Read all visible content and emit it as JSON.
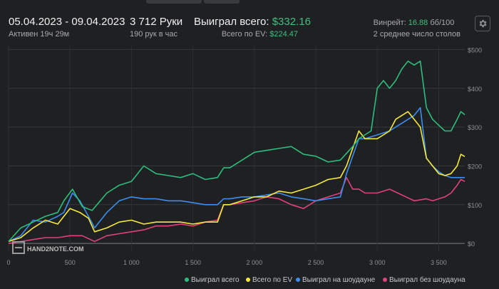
{
  "header": {
    "date_range": "05.04.2023 - 09.04.2023",
    "active_time": "Активен 19ч 29м",
    "hands": "3 712 Руки",
    "hands_per_hour": "190 рук в час",
    "won_total_label": "Выиграл всего:",
    "won_total_value": "$332.16",
    "ev_total_label": "Всего по EV:",
    "ev_total_value": "$224.47",
    "winrate_label": "Винрейт:",
    "winrate_value": "16.88",
    "winrate_unit": "бб/100",
    "avg_tables": "2 среднее число столов"
  },
  "watermark": "HAND2NOTE.COM",
  "colors": {
    "green": "#2dbd7e",
    "yellow": "#f5e93c",
    "blue": "#3b8df0",
    "pink": "#e0417a",
    "accent": "#3fbf7f"
  },
  "icons": {
    "settings": "gear-icon"
  },
  "chart_data": {
    "type": "line",
    "x_ticks": [
      "0",
      "500",
      "1 000",
      "1 500",
      "2 000",
      "2 500",
      "3 000",
      "3 500"
    ],
    "y_ticks": [
      "$0",
      "$100",
      "$200",
      "$300",
      "$400",
      "$500"
    ],
    "xlim": [
      0,
      3712
    ],
    "ylim": [
      -20,
      510
    ],
    "grid": true,
    "legend_position": "bottom",
    "series": [
      {
        "name": "Выиграл всего",
        "color": "#2dbd7e",
        "points": [
          [
            0,
            5
          ],
          [
            100,
            40
          ],
          [
            200,
            55
          ],
          [
            300,
            70
          ],
          [
            400,
            80
          ],
          [
            450,
            110
          ],
          [
            520,
            140
          ],
          [
            600,
            95
          ],
          [
            680,
            85
          ],
          [
            720,
            100
          ],
          [
            800,
            130
          ],
          [
            900,
            150
          ],
          [
            1000,
            160
          ],
          [
            1100,
            200
          ],
          [
            1200,
            180
          ],
          [
            1300,
            175
          ],
          [
            1400,
            170
          ],
          [
            1500,
            180
          ],
          [
            1600,
            165
          ],
          [
            1700,
            170
          ],
          [
            1750,
            195
          ],
          [
            1800,
            195
          ],
          [
            1900,
            215
          ],
          [
            2000,
            235
          ],
          [
            2100,
            240
          ],
          [
            2200,
            245
          ],
          [
            2300,
            250
          ],
          [
            2400,
            230
          ],
          [
            2500,
            225
          ],
          [
            2600,
            210
          ],
          [
            2700,
            215
          ],
          [
            2800,
            250
          ],
          [
            2850,
            270
          ],
          [
            2950,
            290
          ],
          [
            3000,
            400
          ],
          [
            3050,
            420
          ],
          [
            3100,
            400
          ],
          [
            3150,
            420
          ],
          [
            3200,
            450
          ],
          [
            3250,
            470
          ],
          [
            3300,
            460
          ],
          [
            3350,
            470
          ],
          [
            3400,
            350
          ],
          [
            3450,
            320
          ],
          [
            3500,
            305
          ],
          [
            3550,
            290
          ],
          [
            3600,
            290
          ],
          [
            3650,
            320
          ],
          [
            3680,
            340
          ],
          [
            3712,
            332
          ]
        ]
      },
      {
        "name": "Всего по EV",
        "color": "#f5e93c",
        "points": [
          [
            0,
            5
          ],
          [
            100,
            15
          ],
          [
            200,
            40
          ],
          [
            300,
            60
          ],
          [
            400,
            50
          ],
          [
            500,
            90
          ],
          [
            580,
            80
          ],
          [
            650,
            65
          ],
          [
            700,
            30
          ],
          [
            800,
            40
          ],
          [
            900,
            55
          ],
          [
            1000,
            60
          ],
          [
            1100,
            50
          ],
          [
            1200,
            55
          ],
          [
            1300,
            55
          ],
          [
            1400,
            55
          ],
          [
            1500,
            50
          ],
          [
            1600,
            55
          ],
          [
            1700,
            55
          ],
          [
            1750,
            100
          ],
          [
            1800,
            100
          ],
          [
            1900,
            110
          ],
          [
            2000,
            120
          ],
          [
            2100,
            120
          ],
          [
            2200,
            135
          ],
          [
            2300,
            130
          ],
          [
            2400,
            140
          ],
          [
            2500,
            150
          ],
          [
            2600,
            165
          ],
          [
            2700,
            170
          ],
          [
            2750,
            200
          ],
          [
            2850,
            290
          ],
          [
            2900,
            270
          ],
          [
            3000,
            270
          ],
          [
            3050,
            280
          ],
          [
            3100,
            290
          ],
          [
            3150,
            320
          ],
          [
            3200,
            330
          ],
          [
            3250,
            340
          ],
          [
            3300,
            320
          ],
          [
            3350,
            300
          ],
          [
            3400,
            220
          ],
          [
            3450,
            200
          ],
          [
            3500,
            180
          ],
          [
            3550,
            175
          ],
          [
            3600,
            180
          ],
          [
            3650,
            200
          ],
          [
            3680,
            230
          ],
          [
            3712,
            224
          ]
        ]
      },
      {
        "name": "Выиграл на шоудауне",
        "color": "#3b8df0",
        "points": [
          [
            0,
            5
          ],
          [
            100,
            20
          ],
          [
            200,
            60
          ],
          [
            300,
            55
          ],
          [
            400,
            70
          ],
          [
            450,
            80
          ],
          [
            520,
            130
          ],
          [
            580,
            110
          ],
          [
            650,
            70
          ],
          [
            700,
            40
          ],
          [
            800,
            80
          ],
          [
            900,
            110
          ],
          [
            1000,
            120
          ],
          [
            1100,
            115
          ],
          [
            1200,
            115
          ],
          [
            1300,
            110
          ],
          [
            1400,
            110
          ],
          [
            1500,
            105
          ],
          [
            1600,
            100
          ],
          [
            1700,
            100
          ],
          [
            1750,
            115
          ],
          [
            1800,
            115
          ],
          [
            1900,
            120
          ],
          [
            2000,
            120
          ],
          [
            2100,
            125
          ],
          [
            2200,
            130
          ],
          [
            2300,
            120
          ],
          [
            2400,
            115
          ],
          [
            2500,
            110
          ],
          [
            2600,
            115
          ],
          [
            2700,
            120
          ],
          [
            2750,
            180
          ],
          [
            2850,
            270
          ],
          [
            2900,
            270
          ],
          [
            3000,
            280
          ],
          [
            3100,
            290
          ],
          [
            3200,
            310
          ],
          [
            3300,
            330
          ],
          [
            3350,
            350
          ],
          [
            3400,
            220
          ],
          [
            3450,
            200
          ],
          [
            3500,
            185
          ],
          [
            3550,
            175
          ],
          [
            3600,
            170
          ],
          [
            3650,
            170
          ],
          [
            3712,
            170
          ]
        ]
      },
      {
        "name": "Выиграл без шоудауна",
        "color": "#e0417a",
        "points": [
          [
            0,
            0
          ],
          [
            100,
            5
          ],
          [
            200,
            10
          ],
          [
            300,
            15
          ],
          [
            400,
            15
          ],
          [
            500,
            20
          ],
          [
            600,
            20
          ],
          [
            700,
            5
          ],
          [
            800,
            20
          ],
          [
            900,
            25
          ],
          [
            1000,
            30
          ],
          [
            1100,
            35
          ],
          [
            1200,
            45
          ],
          [
            1300,
            45
          ],
          [
            1400,
            50
          ],
          [
            1500,
            45
          ],
          [
            1600,
            55
          ],
          [
            1700,
            60
          ],
          [
            1750,
            100
          ],
          [
            1800,
            100
          ],
          [
            1900,
            105
          ],
          [
            2000,
            110
          ],
          [
            2100,
            120
          ],
          [
            2200,
            115
          ],
          [
            2300,
            100
          ],
          [
            2400,
            90
          ],
          [
            2500,
            110
          ],
          [
            2600,
            120
          ],
          [
            2700,
            130
          ],
          [
            2750,
            170
          ],
          [
            2800,
            140
          ],
          [
            2850,
            140
          ],
          [
            2900,
            130
          ],
          [
            3000,
            130
          ],
          [
            3100,
            140
          ],
          [
            3200,
            125
          ],
          [
            3300,
            110
          ],
          [
            3400,
            115
          ],
          [
            3450,
            110
          ],
          [
            3500,
            115
          ],
          [
            3550,
            120
          ],
          [
            3600,
            130
          ],
          [
            3650,
            150
          ],
          [
            3680,
            165
          ],
          [
            3712,
            160
          ]
        ]
      }
    ]
  }
}
